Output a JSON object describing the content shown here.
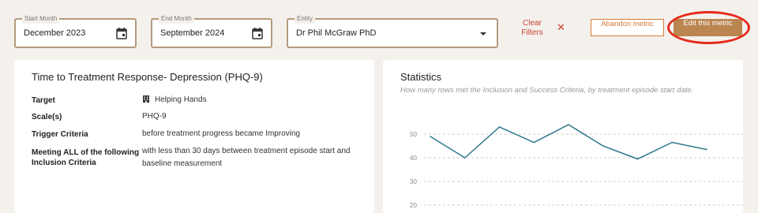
{
  "filters": {
    "start_month": {
      "label": "Start Month",
      "value": "December 2023",
      "icon": "calendar-icon"
    },
    "end_month": {
      "label": "End Month",
      "value": "September 2024",
      "icon": "calendar-icon"
    },
    "entity": {
      "label": "Entity",
      "value": "Dr Phil McGraw PhD",
      "icon": "caret-down-icon"
    },
    "clear_filters_label": "Clear Filters",
    "clear_icon": "✕"
  },
  "actions": {
    "abandon_label": "Abandon metric",
    "edit_label": "Edit this metric",
    "abandon_color": "#d77a37",
    "edit_color": "#bb8550",
    "highlight_color": "#e62a1a"
  },
  "metric": {
    "title": "Time to Treatment Response- Depression (PHQ-9)",
    "rows": [
      {
        "label": "Target",
        "value": "Helping Hands",
        "icon": "building-icon"
      },
      {
        "label": "Scale(s)",
        "value": "PHQ-9"
      },
      {
        "label": "Trigger Criteria",
        "value": "before treatment progress became Improving"
      },
      {
        "label": "Meeting ALL of the following Inclusion Criteria",
        "value": "with less than 30 days between treatment episode start and baseline measurement"
      }
    ]
  },
  "statistics": {
    "title": "Statistics",
    "subtitle": "How many rows met the Inclusion and Success Criteria, by treatment episode start date."
  },
  "chart_data": {
    "type": "line",
    "x": [
      1,
      2,
      3,
      4,
      5,
      6,
      7,
      8,
      9
    ],
    "series": [
      {
        "values": [
          49,
          40,
          53,
          46.5,
          54,
          45,
          39.5,
          46.5,
          43.5
        ],
        "color": "#2a7888"
      }
    ],
    "ylim": [
      20,
      60
    ],
    "yticks": [
      20,
      30,
      40,
      50
    ],
    "grid": true,
    "grid_style": "dashed"
  }
}
